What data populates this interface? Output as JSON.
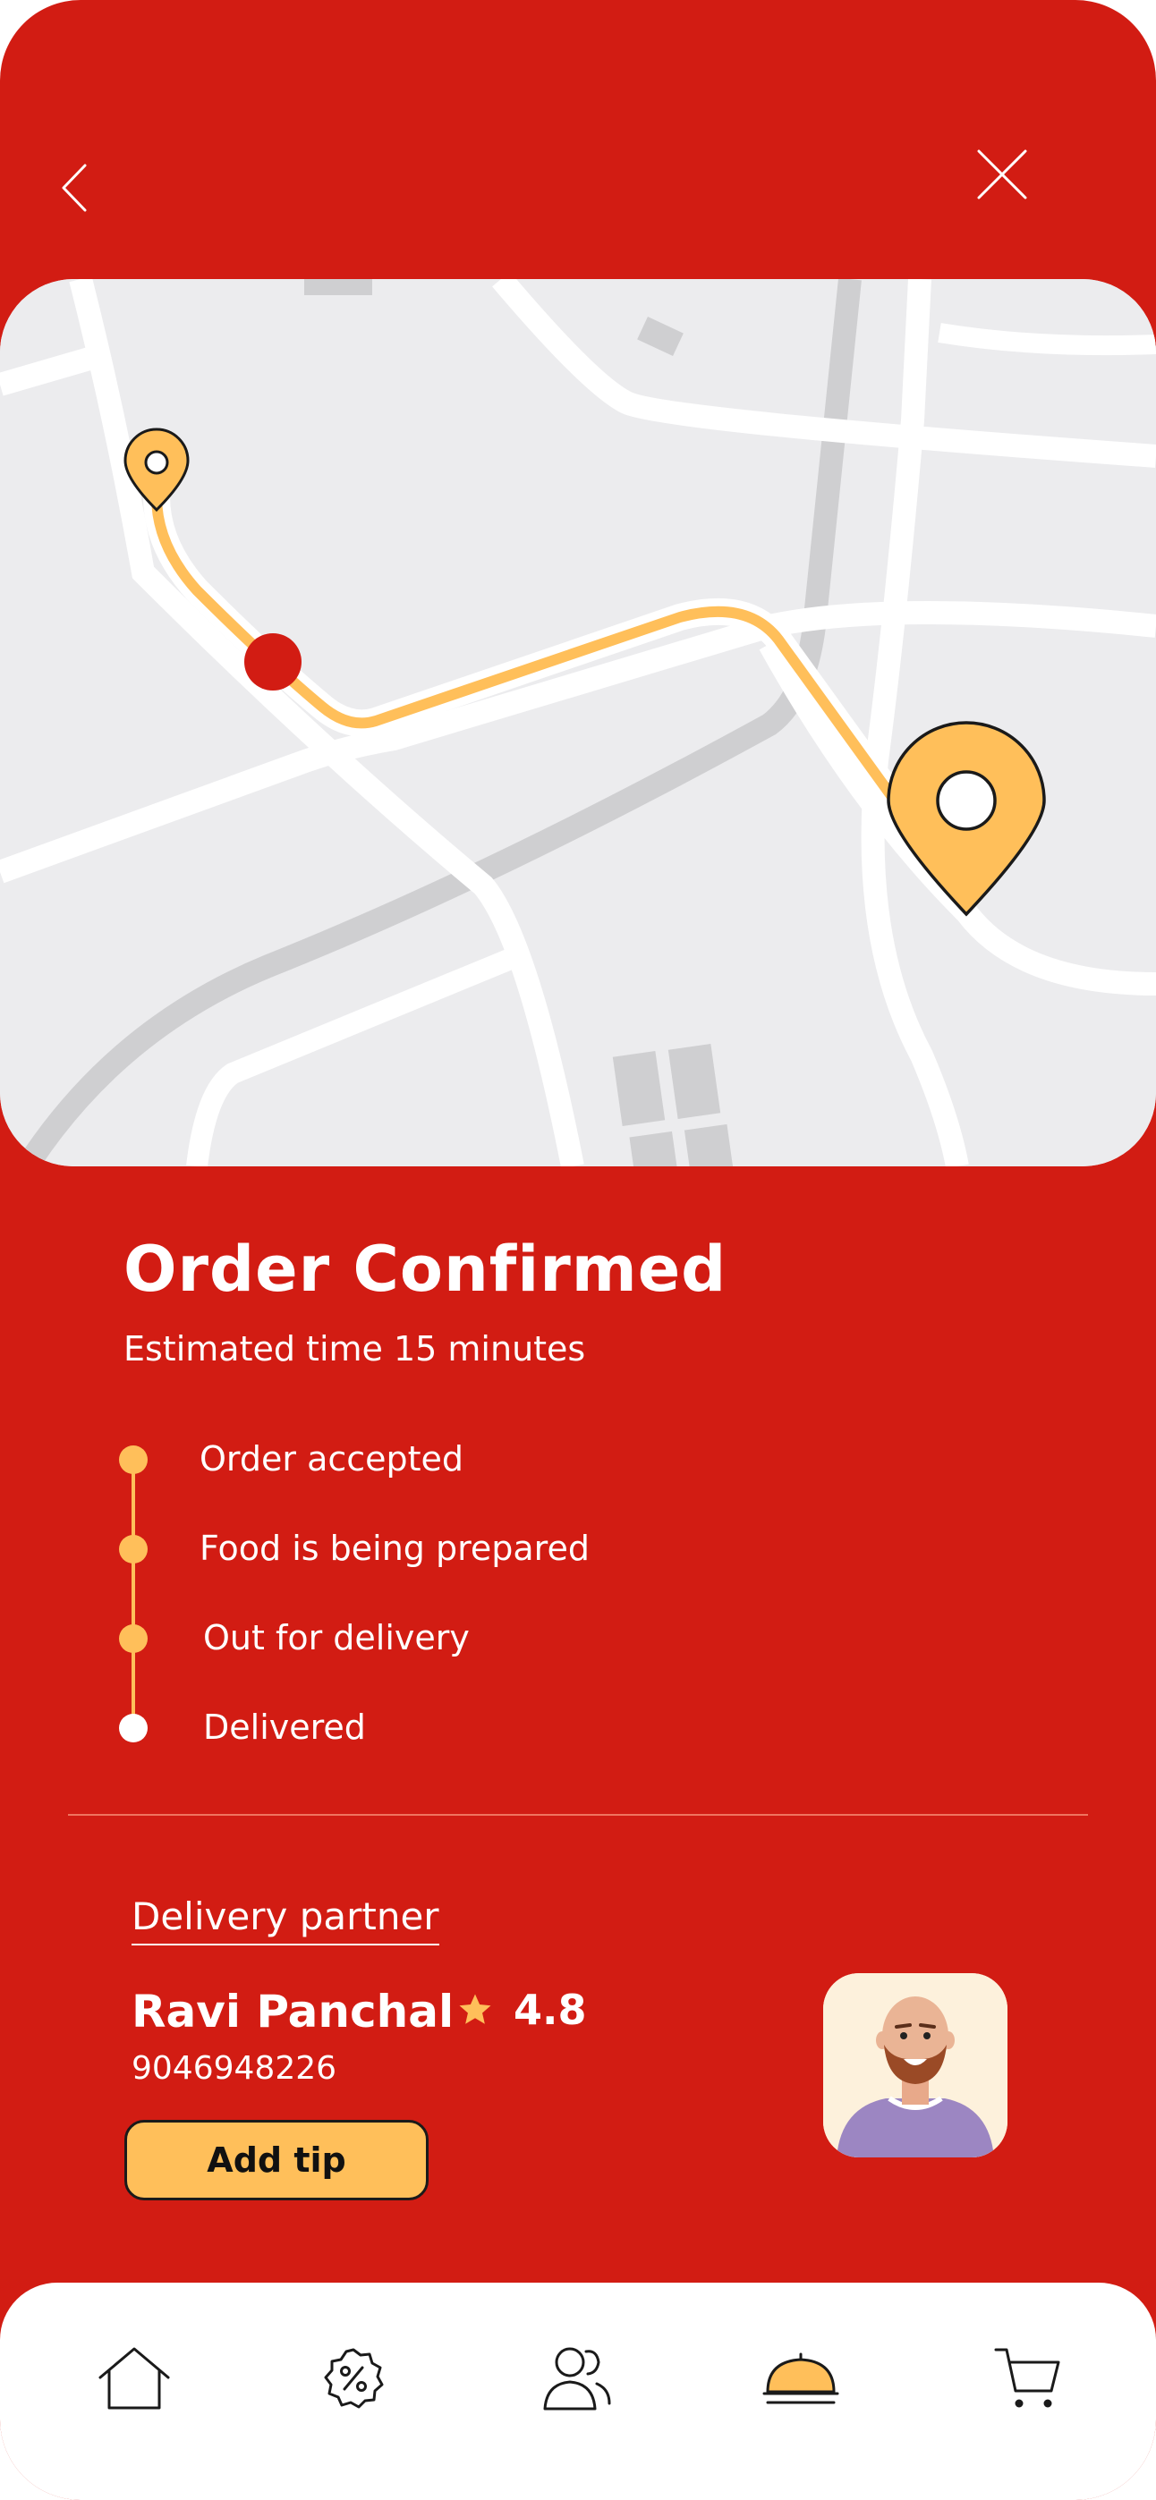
{
  "header": {
    "back_icon": "chevron-left-icon",
    "close_icon": "close-icon"
  },
  "map": {
    "origin_marker": "pin-icon",
    "courier_marker": "courier-dot",
    "destination_marker": "pin-icon",
    "route_color": "#ffbf5a",
    "courier_color": "#d21c13"
  },
  "order": {
    "title": "Order Confirmed",
    "estimate": "Estimated time 15 minutes",
    "steps": [
      {
        "label": "Order accepted",
        "done": true
      },
      {
        "label": "Food is being prepared",
        "done": true
      },
      {
        "label": "Out for delivery",
        "done": true
      },
      {
        "label": "Delivered",
        "done": false
      }
    ]
  },
  "partner": {
    "section_label": "Delivery partner",
    "name": "Ravi Panchal",
    "rating": "4.8",
    "phone": "9046948226",
    "tip_label": "Add tip"
  },
  "nav": {
    "items": [
      {
        "icon": "home-icon"
      },
      {
        "icon": "discount-icon"
      },
      {
        "icon": "users-icon"
      },
      {
        "icon": "cloche-icon",
        "active": true
      },
      {
        "icon": "cart-icon"
      }
    ]
  },
  "colors": {
    "primary": "#d21c13",
    "accent": "#ffbf5a",
    "map_bg": "#ececee"
  }
}
